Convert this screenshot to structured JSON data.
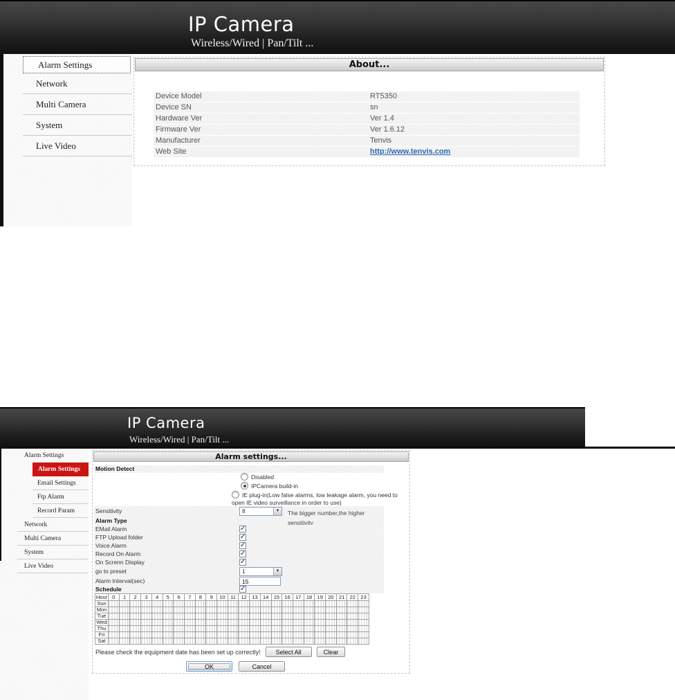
{
  "colors": {
    "accent_red": "#cc1414",
    "link_blue": "#2b6bb0"
  },
  "screen1": {
    "header": {
      "title": "IP Camera",
      "subtitle": "Wireless/Wired | Pan/Tilt ..."
    },
    "sidebar": {
      "items": [
        "Alarm Settings",
        "Network",
        "Multi Camera",
        "System",
        "Live Video"
      ],
      "active_index": 0
    },
    "about": {
      "title": "About...",
      "rows": [
        {
          "label": "Device Model",
          "value": "RT5350",
          "link": false
        },
        {
          "label": "Device SN",
          "value": "sn",
          "link": false
        },
        {
          "label": "Hardware Ver",
          "value": "Ver 1.4",
          "link": false
        },
        {
          "label": "Firmware Ver",
          "value": "Ver 1.6.12",
          "link": false
        },
        {
          "label": "Manufacturer",
          "value": "Tenvis",
          "link": false
        },
        {
          "label": "Web Site",
          "value": "http://www.tenvis.com",
          "link": true
        }
      ]
    }
  },
  "screen2": {
    "header": {
      "title": "IP Camera",
      "subtitle": "Wireless/Wired | Pan/Tilt ..."
    },
    "sidebar": {
      "items": [
        {
          "label": "Alarm Settings",
          "level": 0,
          "expanded": true,
          "active": false
        },
        {
          "label": "Alarm Settings",
          "level": 1,
          "expanded": false,
          "active": true
        },
        {
          "label": "Email Settings",
          "level": 1,
          "expanded": false,
          "active": false
        },
        {
          "label": "Ftp Alarm",
          "level": 1,
          "expanded": false,
          "active": false
        },
        {
          "label": "Record Param",
          "level": 1,
          "expanded": false,
          "active": false
        },
        {
          "label": "Network",
          "level": 0,
          "expanded": false,
          "active": false
        },
        {
          "label": "Multi Camera",
          "level": 0,
          "expanded": false,
          "active": false
        },
        {
          "label": "System",
          "level": 0,
          "expanded": false,
          "active": false
        },
        {
          "label": "Live Video",
          "level": 0,
          "expanded": false,
          "active": false
        }
      ]
    },
    "panel": {
      "title": "Alarm settings...",
      "motion_detect": {
        "label": "Motion Detect",
        "options": [
          {
            "label": "Disabled",
            "checked": false
          },
          {
            "label": "IPCamera build-in",
            "checked": true
          },
          {
            "label": "IE plug-in(Low false alarms, low leakage alarm, you need to open IE video surveillance in order to use)",
            "checked": false
          }
        ]
      },
      "sensitivity": {
        "label": "Sensitivity",
        "value": "8",
        "hint": "The bigger number,the higher sensitivity"
      },
      "alarm_type": {
        "label": "Alarm Type",
        "checkboxes": [
          {
            "label": "EMail Alarm",
            "checked": true
          },
          {
            "label": "FTP Upload folder",
            "checked": true
          },
          {
            "label": "Voice Alarm",
            "checked": true
          },
          {
            "label": "Record On Alarm",
            "checked": true
          },
          {
            "label": "On Screnn Display",
            "checked": true
          }
        ]
      },
      "preset": {
        "label": "go to preset",
        "value": "1"
      },
      "interval": {
        "label": "Alarm Interval(sec)",
        "value": "15"
      },
      "schedule": {
        "label": "Schedule",
        "checked": true,
        "hour_header": "Hour",
        "hours": [
          "0",
          "1",
          "2",
          "3",
          "4",
          "5",
          "6",
          "7",
          "8",
          "9",
          "10",
          "11",
          "12",
          "13",
          "14",
          "15",
          "16",
          "17",
          "18",
          "19",
          "20",
          "21",
          "22",
          "23"
        ],
        "days": [
          "Sun",
          "Mon",
          "Tue",
          "Wed",
          "Thu",
          "Fri",
          "Sat"
        ]
      },
      "note": "Please check the equipment date has been set up correctly!",
      "select_all_label": "Select All",
      "clear_label": "Clear",
      "ok_label": "OK",
      "cancel_label": "Cancel"
    }
  }
}
